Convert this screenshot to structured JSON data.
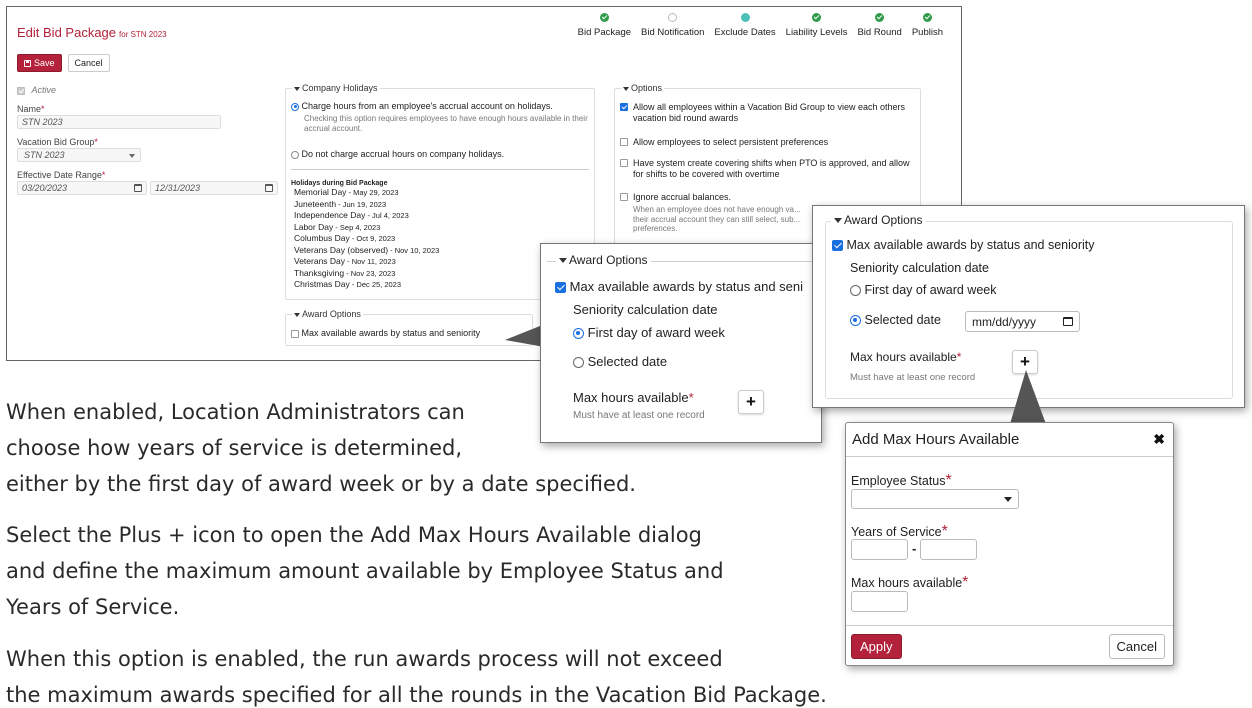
{
  "header": {
    "title": "Edit Bid Package",
    "subtitle": "for STN 2023",
    "save_label": "Save",
    "cancel_label": "Cancel"
  },
  "steps": [
    {
      "label": "Bid Package",
      "state": "done"
    },
    {
      "label": "Bid Notification",
      "state": "empty"
    },
    {
      "label": "Exclude Dates",
      "state": "current"
    },
    {
      "label": "Liability Levels",
      "state": "done"
    },
    {
      "label": "Bid Round",
      "state": "done"
    },
    {
      "label": "Publish",
      "state": "done"
    }
  ],
  "form": {
    "active_label": "Active",
    "name_label": "Name",
    "name_value": "STN 2023",
    "group_label": "Vacation Bid Group",
    "group_value": "STN 2023",
    "date_range_label": "Effective Date Range",
    "date_start": "03/20/2023",
    "date_end": "12/31/2023"
  },
  "company_holidays": {
    "legend": "Company Holidays",
    "option1": "Charge hours from an employee's accrual account on holidays.",
    "option1_note": "Checking this option requires employees to have enough hours available in their accrual account.",
    "option2": "Do not charge accrual hours on company holidays.",
    "holidays_heading": "Holidays during Bid Package",
    "holidays": [
      {
        "name": "Memorial Day",
        "date": "May 29, 2023"
      },
      {
        "name": "Juneteenth",
        "date": "Jun 19, 2023"
      },
      {
        "name": "Independence Day",
        "date": "Jul 4, 2023"
      },
      {
        "name": "Labor Day",
        "date": "Sep 4, 2023"
      },
      {
        "name": "Columbus Day",
        "date": "Oct 9, 2023"
      },
      {
        "name": "Veterans Day (observed)",
        "date": "Nov 10, 2023"
      },
      {
        "name": "Veterans Day",
        "date": "Nov 11, 2023"
      },
      {
        "name": "Thanksgiving",
        "date": "Nov 23, 2023"
      },
      {
        "name": "Christmas Day",
        "date": "Dec 25, 2023"
      }
    ],
    "separator": " - "
  },
  "options": {
    "legend": "Options",
    "opt1": "Allow all employees within a Vacation Bid Group to view each others vacation bid round awards",
    "opt2": "Allow employees to select persistent preferences",
    "opt3": "Have system create covering shifts when PTO is approved, and allow for shifts to be covered with overtime",
    "opt4": "Ignore accrual balances.",
    "opt4_note": "When an employee does not have enough va... their accrual account they can still select, sub... preferences."
  },
  "award_small": {
    "legend": "Award Options",
    "max_label": "Max available awards by status and seniority"
  },
  "award_popup": {
    "legend": "Award Options",
    "max_label": "Max available awards by status and seni",
    "seniority_label": "Seniority calculation date",
    "first_day": "First day of award week",
    "selected_date": "Selected date",
    "max_hours": "Max hours available",
    "must_have": "Must have at least one record"
  },
  "award_popup2": {
    "legend": "Award Options",
    "max_label": "Max available awards by status and seniority",
    "seniority_label": "Seniority calculation date",
    "first_day": "First day of award week",
    "selected_date": "Selected date",
    "date_placeholder": "mm/dd/yyyy",
    "max_hours": "Max hours available",
    "must_have": "Must have at least one record"
  },
  "dialog": {
    "title": "Add Max Hours Available",
    "employee_status": "Employee Status",
    "years_of_service": "Years of Service",
    "range_sep": "-",
    "max_hours": "Max hours available",
    "apply": "Apply",
    "cancel": "Cancel"
  },
  "caption": {
    "p1_l1": "When enabled, Location Administrators can",
    "p1_l2": "choose how years of service is determined,",
    "p1_l3": "either by the first day of award week or by a date specified.",
    "p2_l1": "Select the Plus + icon to open the Add Max Hours Available dialog",
    "p2_l2": "and define the maximum amount available by Employee Status and",
    "p2_l3": "Years of Service.",
    "p3_l1": "When this option is enabled, the run awards process will not exceed",
    "p3_l2": "the maximum awards specified for all the rounds in the Vacation Bid Package."
  }
}
